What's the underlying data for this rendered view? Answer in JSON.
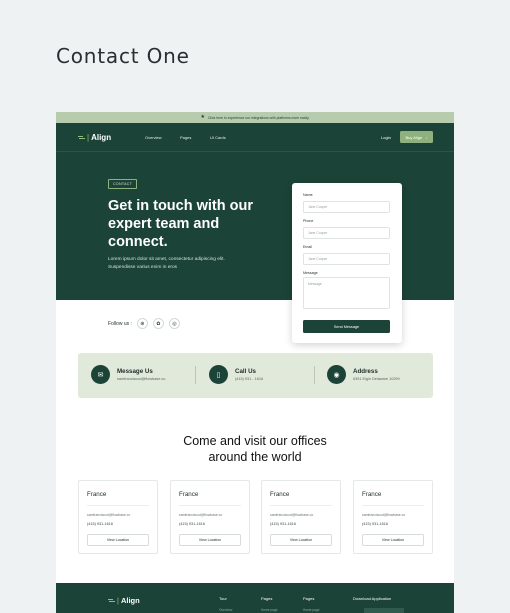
{
  "page_title": "Contact One",
  "banner": {
    "icon": "star-icon",
    "text": "Click here to experience our integrations with platforms more easily."
  },
  "nav": {
    "logo": "Align",
    "links": [
      "Overview",
      "Pages",
      "UI Cards"
    ],
    "login": "Login",
    "buy": "Buy Align",
    "buy_arrow": "›"
  },
  "hero": {
    "tag": "CONTACT",
    "headline": "Get in touch with our expert team and connect.",
    "lead": "Lorem ipsum dolor sit amet, consectetur adipiscing elit. Suspendisse varius enim in eros"
  },
  "form": {
    "name_label": "Name",
    "name_placeholder": "Jane Cooper",
    "phone_label": "Phone",
    "phone_placeholder": "Jane Cooper",
    "email_label": "Email",
    "email_placeholder": "Jane Cooper",
    "message_label": "Message",
    "message_placeholder": "Message",
    "submit": "Send Message"
  },
  "follow": {
    "label": "Follow us :",
    "icons": [
      "⊕",
      "✿",
      "◎"
    ]
  },
  "contact_info": [
    {
      "icon": "mail-icon",
      "glyph": "✉",
      "title": "Message Us",
      "value": "samfranciscod@flowbase.co"
    },
    {
      "icon": "phone-icon",
      "glyph": "▯",
      "title": "Call Us",
      "value": "(415) 931 - 1616"
    },
    {
      "icon": "location-icon",
      "glyph": "◉",
      "title": "Address",
      "value": "6391 Elgin Delaware 10299"
    }
  ],
  "offices": {
    "title_line1": "Come and visit our offices",
    "title_line2": "around the world",
    "items": [
      {
        "name": "France",
        "email": "samfranciscod@flowbase.co",
        "phone": "(415) 931-1616",
        "button": "View Location"
      },
      {
        "name": "France",
        "email": "samfranciscod@flowbase.co",
        "phone": "(415) 931-1616",
        "button": "View Location"
      },
      {
        "name": "France",
        "email": "samfranciscod@flowbase.co",
        "phone": "(415) 931-1616",
        "button": "View Location"
      },
      {
        "name": "France",
        "email": "samfranciscod@flowbase.co",
        "phone": "(415) 931-1616",
        "button": "View Location"
      }
    ]
  },
  "footer": {
    "logo": "Align",
    "col1": "Tour",
    "col2": "Pages",
    "col3": "Pages",
    "col4": "Download Application",
    "sub1": "Overview",
    "sub2": "Home page",
    "sub3": "Home page"
  },
  "colors": {
    "brand_dark": "#1c4337",
    "accent": "#8fb17e",
    "banner": "#b7ccac",
    "info_bg": "#e1e9db"
  }
}
